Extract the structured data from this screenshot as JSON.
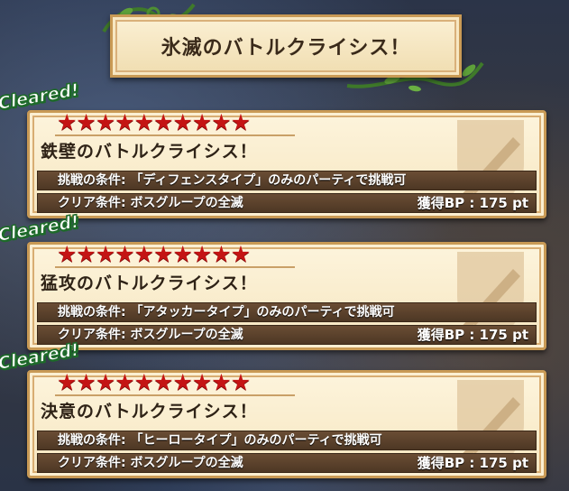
{
  "header": {
    "title": "氷滅のバトルクライシス！"
  },
  "missions": [
    {
      "cleared_label": "Cleared!",
      "stars": "★★★★★★★★★★",
      "star_count": 10,
      "title": "鉄壁のバトルクライシス！",
      "condition": "挑戦の条件: 「ディフェンスタイプ」のみのパーティで挑戦可",
      "clear_condition": "クリア条件: ボスグループの全滅",
      "bp": "獲得BP : 175 pt"
    },
    {
      "cleared_label": "Cleared!",
      "stars": "★★★★★★★★★★",
      "star_count": 10,
      "title": "猛攻のバトルクライシス！",
      "condition": "挑戦の条件: 「アタッカータイプ」のみのパーティで挑戦可",
      "clear_condition": "クリア条件: ボスグループの全滅",
      "bp": "獲得BP : 175 pt"
    },
    {
      "cleared_label": "Cleared!",
      "stars": "★★★★★★★★★★",
      "star_count": 10,
      "title": "決意のバトルクライシス！",
      "condition": "挑戦の条件: 「ヒーロータイプ」のみのパーティで挑戦可",
      "clear_condition": "クリア条件: ボスグループの全滅",
      "bp": "獲得BP : 175 pt"
    }
  ],
  "colors": {
    "star": "#c41414",
    "cleared_outline": "#1e6b2a",
    "bar": "#5a412b",
    "frame": "#c99a55"
  },
  "icons": {
    "card_emblem": "sword-shield-icon",
    "decoration": "vine-icon"
  }
}
